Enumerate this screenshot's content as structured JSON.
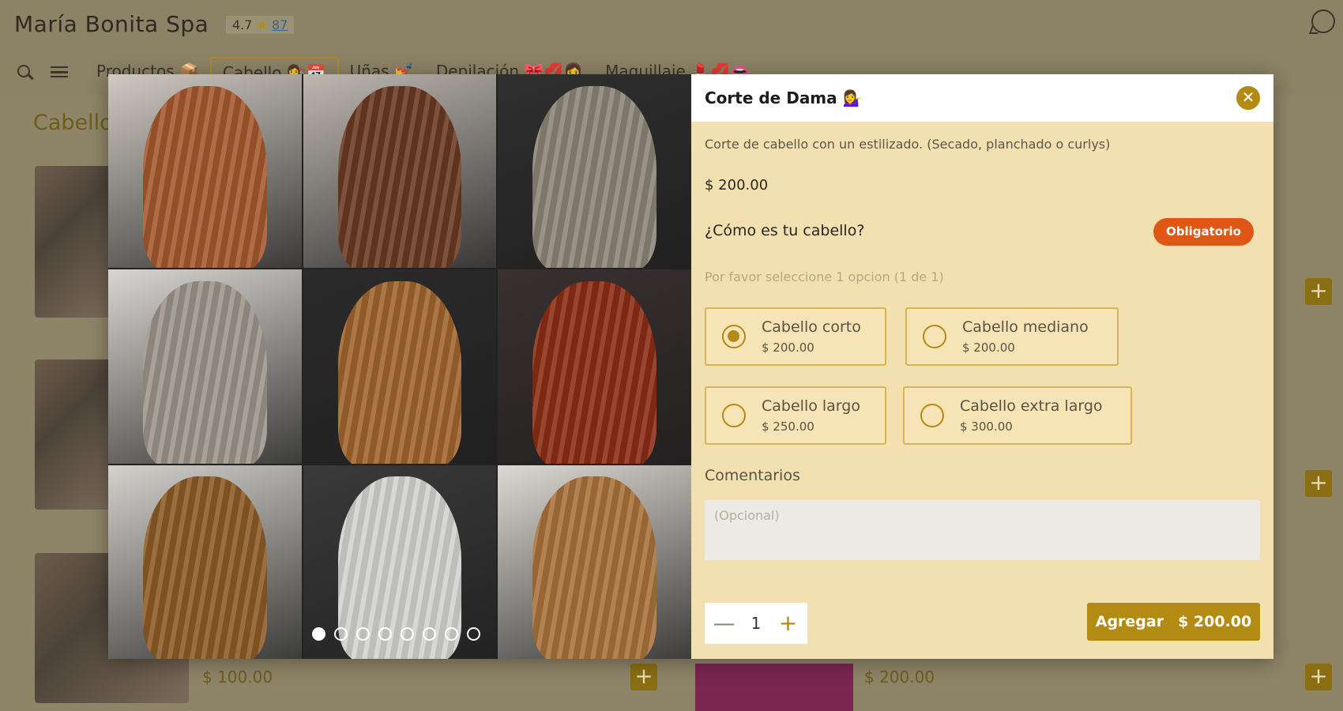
{
  "header": {
    "brand": "María Bonita Spa",
    "rating": "4.7",
    "star": "★",
    "reviews": "87"
  },
  "nav": {
    "tabs": [
      {
        "label": "Productos 📦"
      },
      {
        "label": "Cabello 💇‍♀️📅"
      },
      {
        "label": "Uñas 💅"
      },
      {
        "label": "Depilación 🎀💋👩"
      },
      {
        "label": "Maquillaje 💄💋👄"
      }
    ]
  },
  "section": {
    "title": "Cabello"
  },
  "background": {
    "price_left": "$ 100.00",
    "price_right": "$ 200.00",
    "plus": "+"
  },
  "modal": {
    "title": "Corte de Dama 💁‍♀️",
    "close": "✕",
    "description": "Corte de cabello con un estilizado. (Secado, planchado o curlys)",
    "price": "$ 200.00",
    "question": "¿Cómo es tu cabello?",
    "required_badge": "Obligatorio",
    "hint": "Por favor seleccione 1 opcion (1 de 1)",
    "options": [
      {
        "name": "Cabello corto",
        "price": "$ 200.00",
        "checked": true
      },
      {
        "name": "Cabello mediano",
        "price": "$ 200.00",
        "checked": false
      },
      {
        "name": "Cabello largo",
        "price": "$ 250.00",
        "checked": false
      },
      {
        "name": "Cabello extra largo",
        "price": "$ 300.00",
        "checked": false
      }
    ],
    "comments_label": "Comentarios",
    "comments_placeholder": "(Opcional)",
    "quantity": "1",
    "minus": "—",
    "plus": "+",
    "add_label": "Agregar",
    "add_price": "$ 200.00"
  },
  "gallery": {
    "photos": [
      {
        "hair": "#a4582c",
        "bg": "#cfc9c2"
      },
      {
        "hair": "#6a3a22",
        "bg": "#bdb7b0"
      },
      {
        "hair": "#8a8476",
        "bg": "#2f2f2f"
      },
      {
        "hair": "#9c948a",
        "bg": "#d8d6d2"
      },
      {
        "hair": "#a0642c",
        "bg": "#2b2b2b"
      },
      {
        "hair": "#8a2c14",
        "bg": "#3a3030"
      },
      {
        "hair": "#8c5a24",
        "bg": "#d3d1cc"
      },
      {
        "hair": "#d2d2cf",
        "bg": "#3a3a3a"
      },
      {
        "hair": "#a8713a",
        "bg": "#dcd8d2"
      }
    ],
    "slides": 8,
    "active_slide": 1
  },
  "colors": {
    "accent": "#b38a12",
    "panel": "#f3e0b0",
    "badge": "#e05614"
  }
}
